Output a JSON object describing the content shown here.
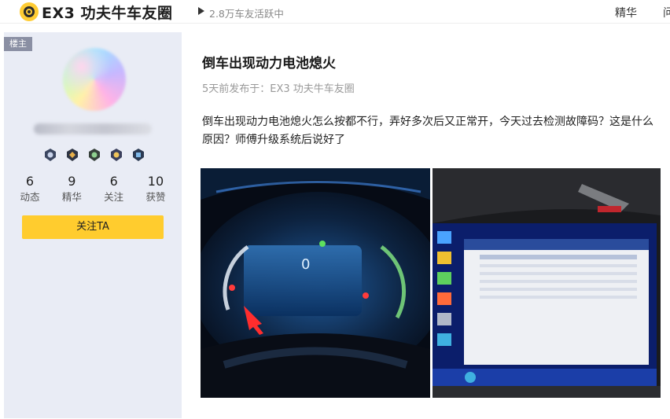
{
  "header": {
    "logo_icon": "circle-target-icon",
    "title": "EX3 功夫牛车友圈",
    "active_text": "2.8万车友活跃中",
    "nav_tabs": [
      {
        "label": "精华"
      },
      {
        "label": "问"
      }
    ]
  },
  "sidebar": {
    "host_badge": "楼主",
    "medals": [
      "medal-1-icon",
      "medal-2-icon",
      "medal-3-icon",
      "medal-4-icon",
      "medal-5-icon"
    ],
    "stats": [
      {
        "value": "6",
        "label": "动态"
      },
      {
        "value": "9",
        "label": "精华"
      },
      {
        "value": "6",
        "label": "关注"
      },
      {
        "value": "10",
        "label": "获赞"
      }
    ],
    "follow_label": "关注TA"
  },
  "post": {
    "title": "倒车出现动力电池熄火",
    "meta": "5天前发布于：EX3 功夫牛车友圈",
    "body": "倒车出现动力电池熄火怎么按都不行，弄好多次后又正常开，今天过去检测故障码？这是什么原因？师傅升级系统后说好了",
    "photos": [
      {
        "name": "dashboard-photo"
      },
      {
        "name": "diagnostic-laptop-photo"
      }
    ]
  },
  "colors": {
    "accent": "#ffcc2e",
    "sidebar_bg": "#e9ecf5",
    "host_badge": "#8a8fa3",
    "meta_text": "#999999"
  }
}
